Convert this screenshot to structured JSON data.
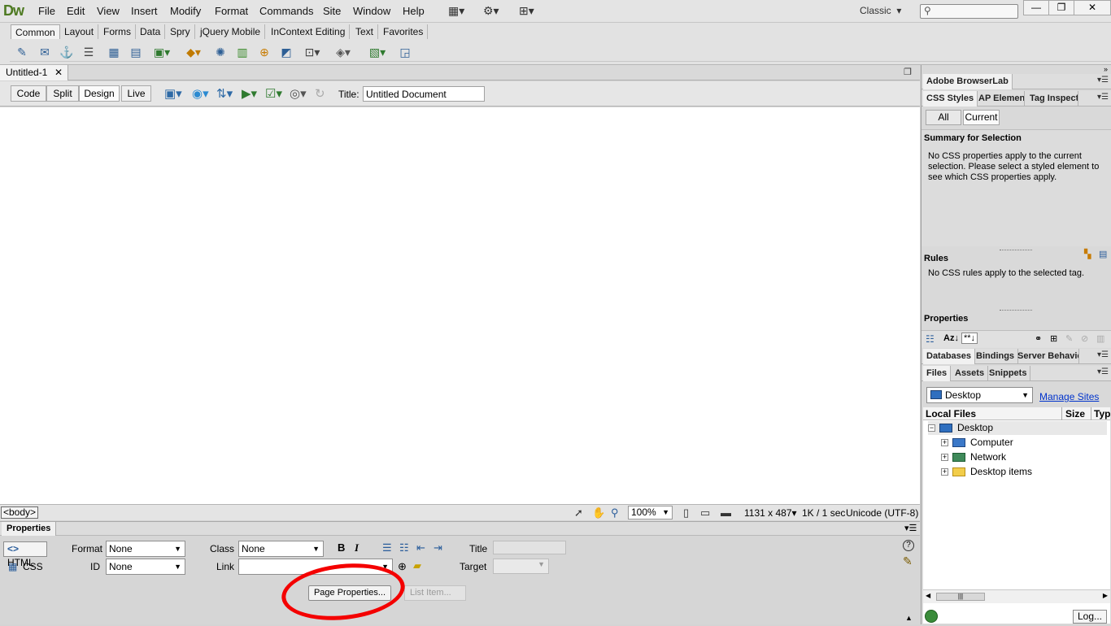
{
  "app": {
    "logo": "Dw",
    "menus": [
      "File",
      "Edit",
      "View",
      "Insert",
      "Modify",
      "Format",
      "Commands",
      "Site",
      "Window",
      "Help"
    ],
    "workspace": "Classic",
    "workspace_arrow": "▾",
    "search_glyph": "⚲",
    "win_controls": {
      "minimize": "—",
      "restore": "❐",
      "close": "✕"
    }
  },
  "insert_bar": {
    "tabs": [
      "Common",
      "Layout",
      "Forms",
      "Data",
      "Spry",
      "jQuery Mobile",
      "InContext Editing",
      "Text",
      "Favorites"
    ],
    "active_tab": "Common"
  },
  "document": {
    "tab_name": "Untitled-1",
    "tab_close": "✕",
    "view_buttons": [
      "Code",
      "Split",
      "Design",
      "Live"
    ],
    "active_view": "Design",
    "title_label": "Title:",
    "title_value": "Untitled Document"
  },
  "status_bar": {
    "tag": "<body>",
    "zoom": "100%",
    "dimensions": "1131 x 487",
    "dimensions_arrow": "▾",
    "download": "1K / 1 sec",
    "encoding": "Unicode (UTF-8)"
  },
  "properties": {
    "tab": "Properties",
    "html_label": "HTML",
    "css_label": "CSS",
    "format_label": "Format",
    "format_value": "None",
    "class_label": "Class",
    "class_value": "None",
    "id_label": "ID",
    "id_value": "None",
    "link_label": "Link",
    "title_label": "Title",
    "target_label": "Target",
    "bold": "B",
    "italic": "I",
    "page_properties": "Page Properties...",
    "list_item": "List Item..."
  },
  "right_panels": {
    "browserlab": "Adobe BrowserLab",
    "css_tabs": [
      "CSS Styles",
      "AP Elements",
      "Tag Inspector"
    ],
    "all_label": "All",
    "current_label": "Current",
    "summary_title": "Summary for Selection",
    "summary_text": "No CSS properties apply to the current selection.  Please select a styled element to see which CSS properties apply.",
    "rules_title": "Rules",
    "rules_text": "No CSS rules apply to the selected tag.",
    "properties_title": "Properties",
    "db_tabs": [
      "Databases",
      "Bindings",
      "Server Behaviors"
    ],
    "files_tabs": [
      "Files",
      "Assets",
      "Snippets"
    ],
    "site_select": "Desktop",
    "manage_sites": "Manage Sites",
    "local_files": "Local Files",
    "size_col": "Size",
    "type_col": "Typ",
    "tree": [
      {
        "label": "Desktop",
        "toggle": "−",
        "level": 0
      },
      {
        "label": "Computer",
        "toggle": "+",
        "level": 1
      },
      {
        "label": "Network",
        "toggle": "+",
        "level": 1
      },
      {
        "label": "Desktop items",
        "toggle": "+",
        "level": 1
      }
    ],
    "log_button": "Log..."
  },
  "colors": {
    "dw_logo": "#4e7a22",
    "annotation": "#f40000",
    "link": "#0033cc"
  }
}
